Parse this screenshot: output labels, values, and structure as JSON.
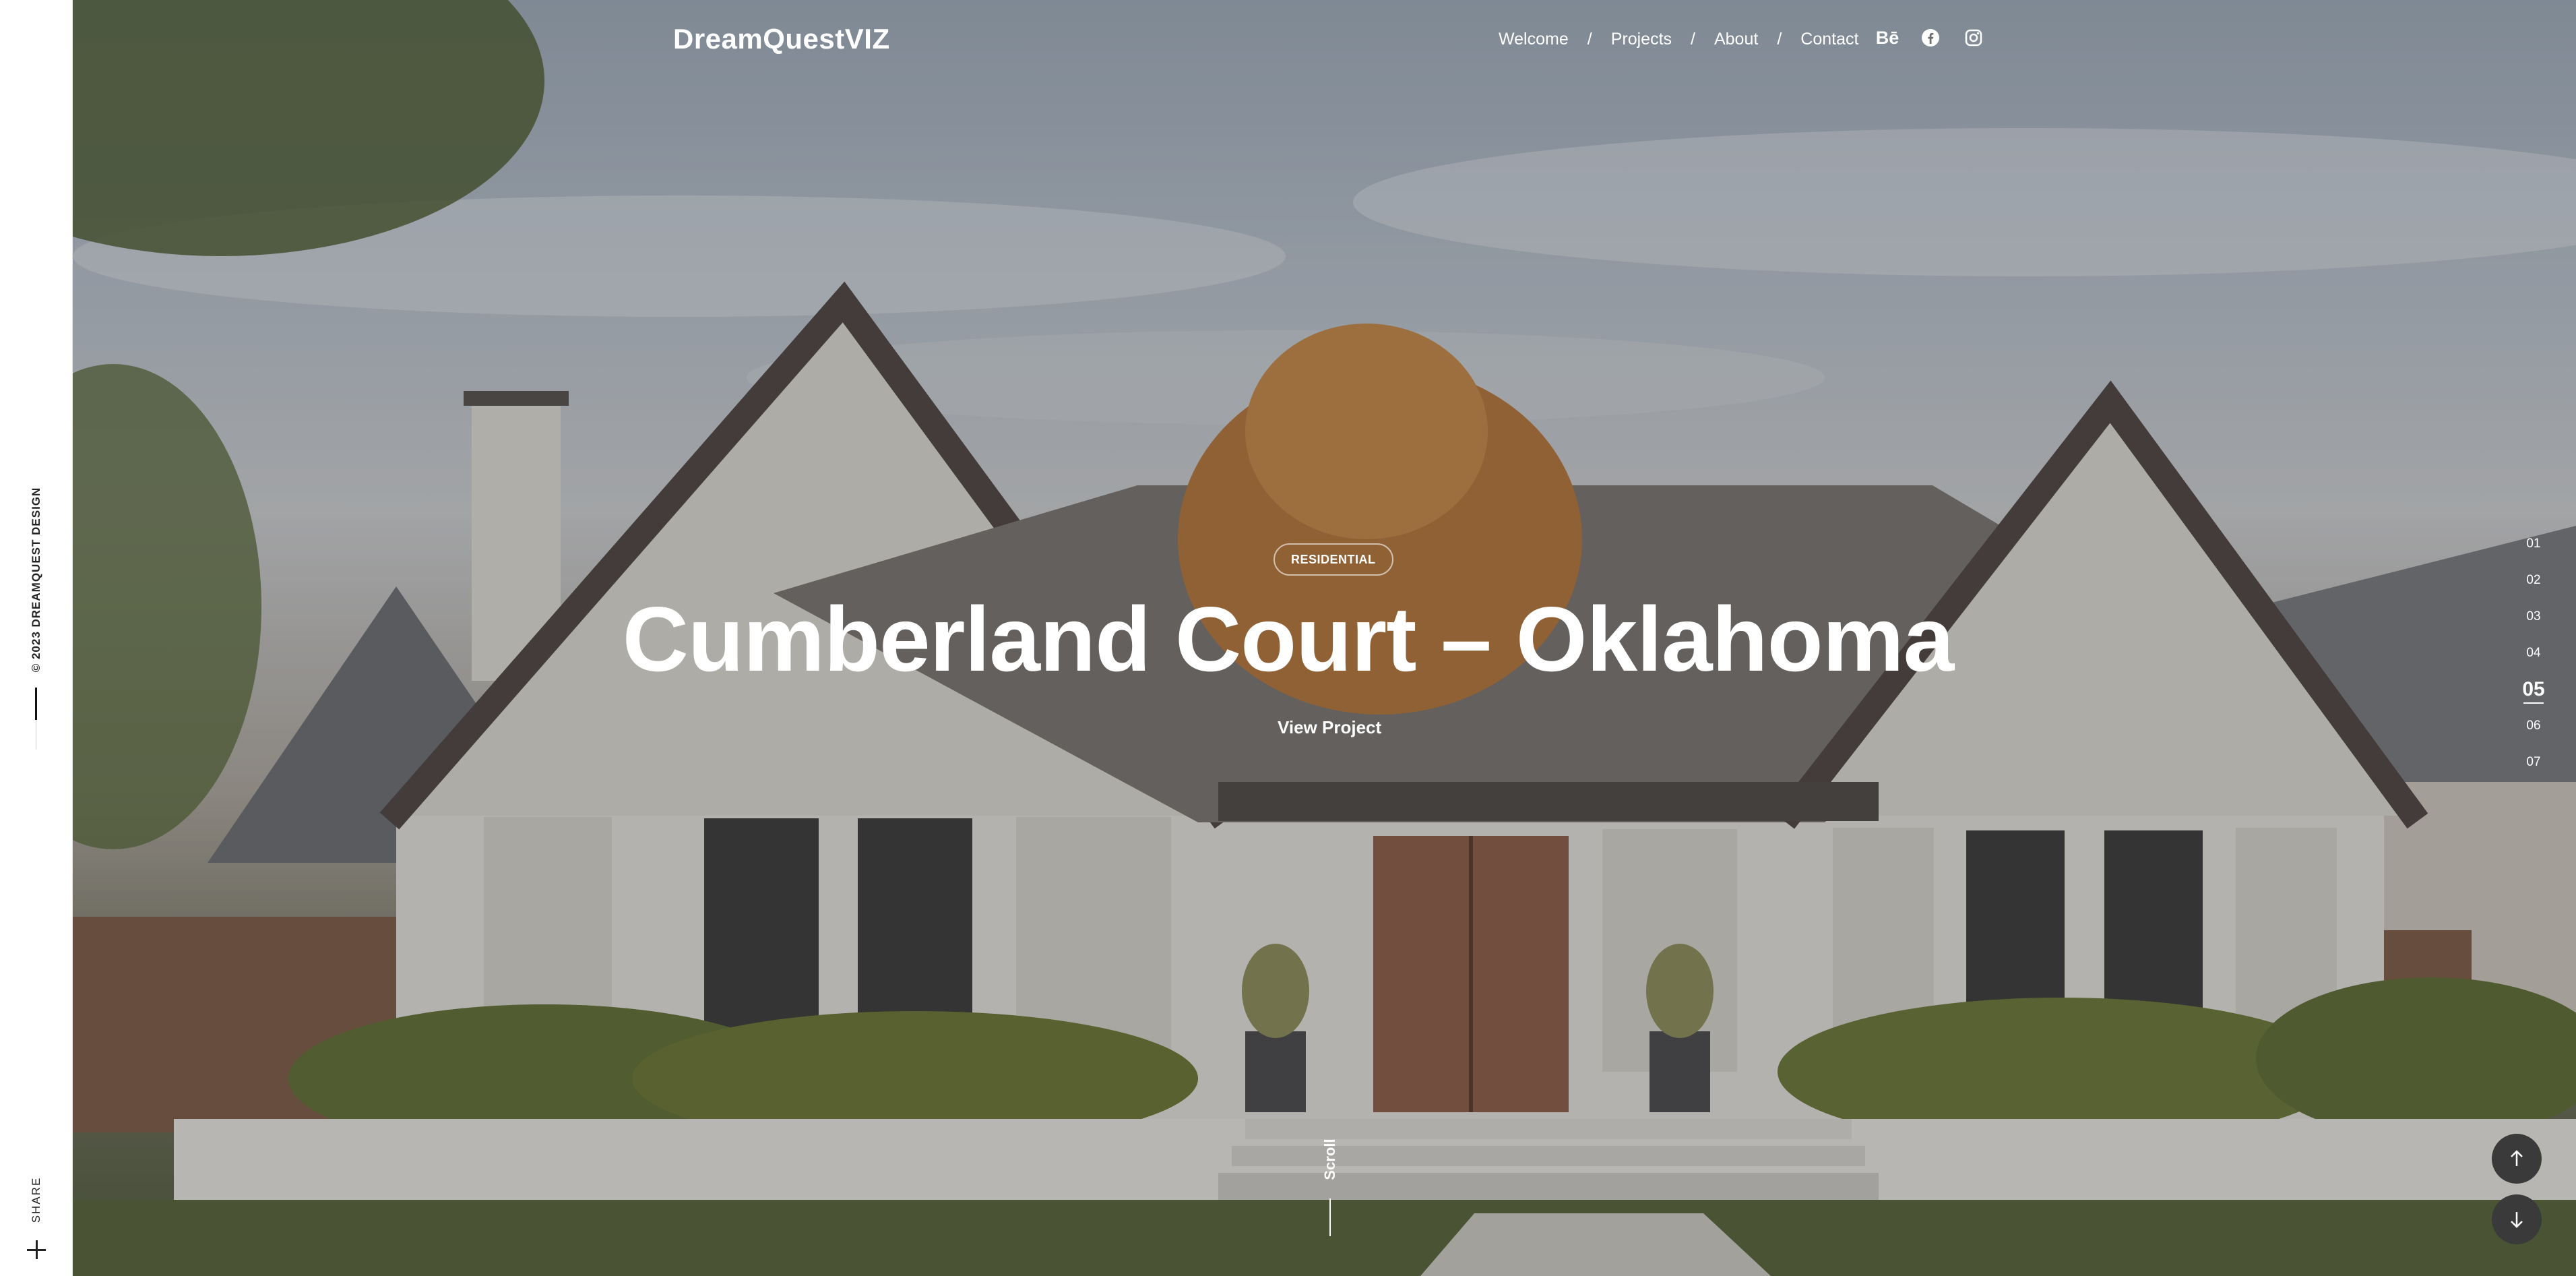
{
  "side": {
    "copyright": "© 2023 DREAMQUEST DESIGN",
    "share_label": "SHARE"
  },
  "header": {
    "brand": "DreamQuestVIZ",
    "nav": [
      {
        "label": "Welcome"
      },
      {
        "label": "Projects"
      },
      {
        "label": "About"
      },
      {
        "label": "Contact"
      }
    ],
    "separator": "/",
    "social": [
      {
        "icon": "behance-icon",
        "label": "Bē"
      },
      {
        "icon": "facebook-icon"
      },
      {
        "icon": "instagram-icon"
      }
    ]
  },
  "hero": {
    "category": "RESIDENTIAL",
    "title": "Cumberland Court – Oklahoma",
    "cta": "View Project",
    "scroll_label": "Scroll"
  },
  "pager": {
    "items": [
      "01",
      "02",
      "03",
      "04",
      "05",
      "06",
      "07"
    ],
    "active_index": 4
  },
  "colors": {
    "overlay": "#1e1e1e",
    "round_button": "#3a3a3a",
    "text": "#ffffff"
  }
}
